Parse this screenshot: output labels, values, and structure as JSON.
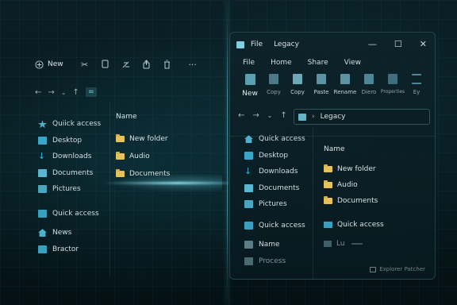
{
  "left_window": {
    "toolbar": {
      "new_label": "New"
    },
    "sidebar": [
      {
        "label": "Quiick access",
        "icon": "star-icon",
        "color": "#4fb0d0"
      },
      {
        "label": "Desktop",
        "icon": "desktop-icon",
        "color": "#3aa7c9"
      },
      {
        "label": "Downloads",
        "icon": "download-icon",
        "color": "#3ab0d8"
      },
      {
        "label": "Documents",
        "icon": "documents-icon",
        "color": "#5ab7cf"
      },
      {
        "label": "Pictures",
        "icon": "pictures-icon",
        "color": "#4aa6c0"
      },
      {
        "label": "",
        "icon": "",
        "color": ""
      },
      {
        "label": "Quick access",
        "icon": "monitor-icon",
        "color": "#3aa0c0"
      },
      {
        "label": "",
        "icon": "",
        "color": ""
      },
      {
        "label": "News",
        "icon": "home-icon",
        "color": "#4fb0d0"
      },
      {
        "label": "Bractor",
        "icon": "folder-icon",
        "color": "#3aa0c0"
      }
    ],
    "main": {
      "header": "Name",
      "items": [
        "New folder",
        "Audio",
        "Documents"
      ]
    }
  },
  "right_window": {
    "title_app": "File",
    "title": "Legacy",
    "menu": [
      "File",
      "Home",
      "Share",
      "View"
    ],
    "ribbon": [
      "New",
      "Copy",
      "Copy",
      "Paste",
      "Rename",
      "Diero",
      "Properties",
      "Ey"
    ],
    "address": "Legacy",
    "sidebar": [
      {
        "label": "Quick access",
        "icon": "home-icon",
        "color": "#4fb0d0",
        "faded": false
      },
      {
        "label": "Desktop",
        "icon": "desktop-icon",
        "color": "#3aa7c9",
        "faded": false
      },
      {
        "label": "Downloads",
        "icon": "download-icon",
        "color": "#3ab0d8",
        "faded": false
      },
      {
        "label": "Documents",
        "icon": "documents-icon",
        "color": "#5ab7cf",
        "faded": false
      },
      {
        "label": "Pictures",
        "icon": "pictures-icon",
        "color": "#4aa6c0",
        "faded": false
      },
      {
        "label": "",
        "icon": "",
        "color": "",
        "faded": false
      },
      {
        "label": "Quick access",
        "icon": "monitor-icon",
        "color": "#3aa0c0",
        "faded": false
      },
      {
        "label": "",
        "icon": "",
        "color": "",
        "faded": false
      },
      {
        "label": "Name",
        "icon": "folder-icon",
        "color": "#5b7e86",
        "faded": false
      },
      {
        "label": "Process",
        "icon": "folder-icon",
        "color": "#4a6a72",
        "faded": true
      }
    ],
    "main": {
      "header": "Name",
      "items": [
        "New folder",
        "Audio",
        "Documents"
      ],
      "section": "Quick access",
      "extra": "Lu"
    },
    "brand": "Explorer Patcher"
  },
  "colors": {
    "accent": "#7fd4e2",
    "folder": "#e6c25a",
    "background": "#061418"
  }
}
